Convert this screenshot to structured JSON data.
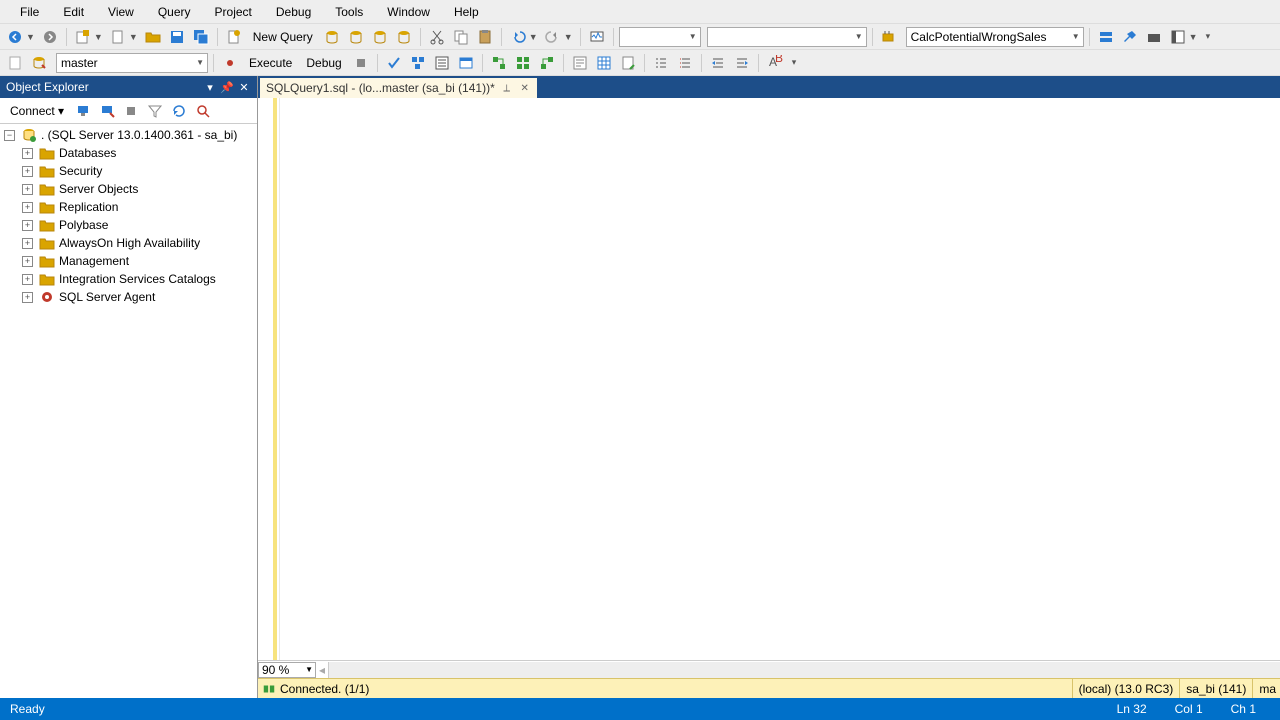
{
  "menu": {
    "items": [
      "File",
      "Edit",
      "View",
      "Query",
      "Project",
      "Debug",
      "Tools",
      "Window",
      "Help"
    ]
  },
  "toolbar1": {
    "new_query": "New Query",
    "combo1": "",
    "combo2": "",
    "proc_combo": "CalcPotentialWrongSales"
  },
  "toolbar2": {
    "db_combo": "master",
    "execute": "Execute",
    "debug": "Debug"
  },
  "explorer": {
    "title": "Object Explorer",
    "connect": "Connect",
    "root": ". (SQL Server 13.0.1400.361 - sa_bi)",
    "nodes": [
      {
        "label": "Databases",
        "icon": "folder"
      },
      {
        "label": "Security",
        "icon": "folder"
      },
      {
        "label": "Server Objects",
        "icon": "folder"
      },
      {
        "label": "Replication",
        "icon": "folder"
      },
      {
        "label": "Polybase",
        "icon": "folder"
      },
      {
        "label": "AlwaysOn High Availability",
        "icon": "folder"
      },
      {
        "label": "Management",
        "icon": "folder"
      },
      {
        "label": "Integration Services Catalogs",
        "icon": "folder"
      },
      {
        "label": "SQL Server Agent",
        "icon": "agent"
      }
    ]
  },
  "tab": {
    "label": "SQLQuery1.sql - (lo...master (sa_bi (141))*"
  },
  "zoom": "90 %",
  "conn": {
    "status": "Connected. (1/1)",
    "server": "(local) (13.0 RC3)",
    "user": "sa_bi (141)",
    "db": "ma"
  },
  "status": {
    "ready": "Ready",
    "ln": "Ln 32",
    "col": "Col 1",
    "ch": "Ch 1"
  }
}
